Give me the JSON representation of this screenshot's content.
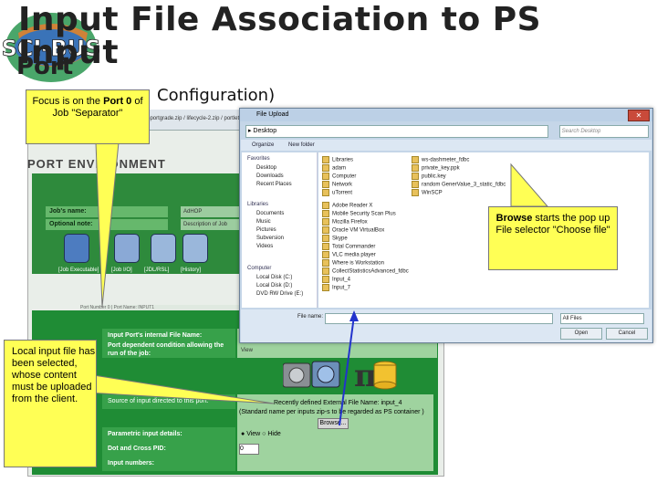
{
  "slide": {
    "title_line1": "Input File Association to PS Input",
    "title_line2": "Port",
    "title_line3": "Configuration)",
    "logo_text": "SCI-BUS"
  },
  "callouts": {
    "focus": {
      "prefix": "Focus is on the ",
      "bold": "Port 0",
      "suffix": " of Job \"Separator\""
    },
    "browse": {
      "bold": "Browse",
      "text": " starts the pop up File selector \"Choose file\""
    },
    "local": "Local input file has been selected, whose content must be uploaded from the client."
  },
  "file_dialog": {
    "title": "File Upload",
    "address": "Desktop",
    "search_placeholder": "Search Desktop",
    "toolbar": [
      "Organize",
      "New folder"
    ],
    "nav_sections": [
      {
        "header": "Favorites",
        "items": [
          "Desktop",
          "Downloads",
          "Recent Places"
        ]
      },
      {
        "header": "Libraries",
        "items": [
          "Documents",
          "Music",
          "Pictures",
          "Subversion",
          "Videos"
        ]
      },
      {
        "header": "Computer",
        "items": [
          "Local Disk (C:)",
          "Local Disk (D:)",
          "DVD RW Drive (E:)"
        ]
      }
    ],
    "files_col1": [
      "Libraries",
      "adam",
      "Computer",
      "Network",
      "uTorrent",
      "Adobe Reader X",
      "Mobile Security Scan Plus",
      "Mozilla Firefox",
      "Oracle VM VirtualBox",
      "Skype",
      "Total Commander",
      "VLC media player",
      "Where is Workstation",
      "CollectStatisticsAdvanced_fdbc",
      "Input_4",
      "Input_7"
    ],
    "files_col2": [
      "ws-dashmeter_fdbc",
      "private_key.ppk",
      "public.key",
      "random GenerValue_3_static_fdbc",
      "WinSCP"
    ],
    "file_name_label": "File name:",
    "file_type": "All Files",
    "open_label": "Open",
    "cancel_label": "Cancel"
  },
  "background_app": {
    "browser_tab": "WAR: wsportgrade.zip / lifecycle-2.zip / portlet/1.d.a",
    "header": "PORT ENVIRONMENT",
    "job_name_label": "Job's name:",
    "job_name_value": "AdHOP",
    "optional_note_label": "Optional note:",
    "optional_note_value": "Description of Job",
    "tabs": [
      "[Job Executable]",
      "[Job I/O]",
      "[JDL/RSL]",
      "[History]"
    ],
    "port_label": "Port Number 0 | Port Name: INPUT1",
    "rows": [
      "Input Port's internal File Name:",
      "Port dependent condition allowing the run of the job:",
      "Source of input directed to this port:",
      "Parametric input details:",
      "Dot and Cross PID:",
      "Input numbers:"
    ],
    "recent_text": "Recently defined External File Name: input_4",
    "standard_text": "(Standard name per inputs zip-s to be regarded as PS container )",
    "browse_label": "Browse...",
    "radio_view": "View",
    "radio_hide": "Hide",
    "dot_value": "0",
    "view_label": "View"
  },
  "colors": {
    "callout": "#ffff55",
    "green_dark": "#1f8c35",
    "green_light": "#9fd39f",
    "arrow": "#2233cc"
  }
}
